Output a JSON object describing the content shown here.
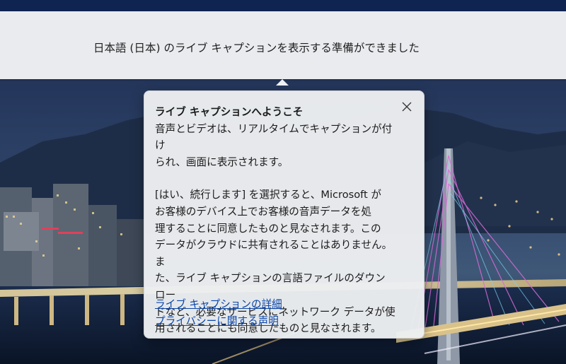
{
  "colors": {
    "banner_bg": "#e9ebee",
    "flyout_bg": "#eceef1",
    "link": "#0a45a8",
    "text": "#1b1b1b"
  },
  "banner": {
    "text": "日本語 (日本) のライブ キャプションを表示する準備ができました"
  },
  "flyout": {
    "title": "ライブ キャプションへようこそ",
    "paragraph1_lines": [
      "音声とビデオは、リアルタイムでキャプションが付け",
      "られ、画面に表示されます。"
    ],
    "paragraph2_lines": [
      "[はい、続行します] を選択すると、Microsoft が",
      "お客様のデバイス上でお客様の音声データを処",
      "理することに同意したものと見なされます。この",
      "データがクラウドに共有されることはありません。ま",
      "た、ライブ キャプションの言語ファイルのダウンロー",
      "ドなど、必要なサービスにネットワーク データが使",
      "用されることにも同意したものと見なされます。"
    ],
    "links": {
      "details": "ライブ キャプションの詳細",
      "privacy": "プライバシーに関する声明"
    },
    "close_icon": "close-icon"
  }
}
